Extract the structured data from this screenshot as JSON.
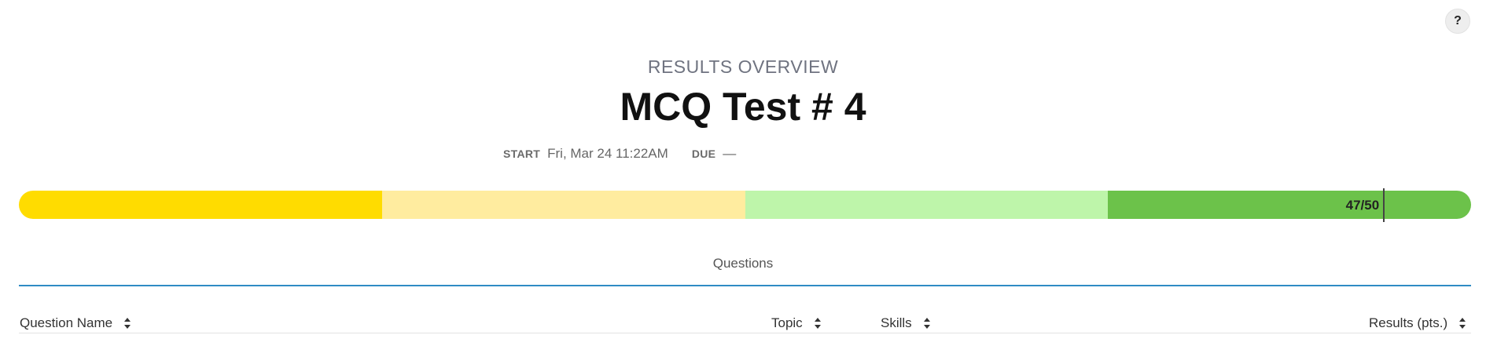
{
  "help": {
    "label": "?"
  },
  "header": {
    "overview_label": "RESULTS OVERVIEW",
    "title": "MCQ Test # 4"
  },
  "meta": {
    "start_key": "START",
    "start_value": "Fri, Mar 24 11:22AM",
    "due_key": "DUE",
    "due_value": "—"
  },
  "progress": {
    "score_text": "47/50",
    "score": 47,
    "max": 50,
    "segment_colors": [
      "#FFDC00",
      "#FFEC9F",
      "#BEF5AA",
      "#6CC24A"
    ]
  },
  "tabs": {
    "questions": "Questions"
  },
  "table": {
    "columns": {
      "question_name": "Question Name",
      "topic": "Topic",
      "skills": "Skills",
      "results": "Results (pts.)"
    }
  }
}
